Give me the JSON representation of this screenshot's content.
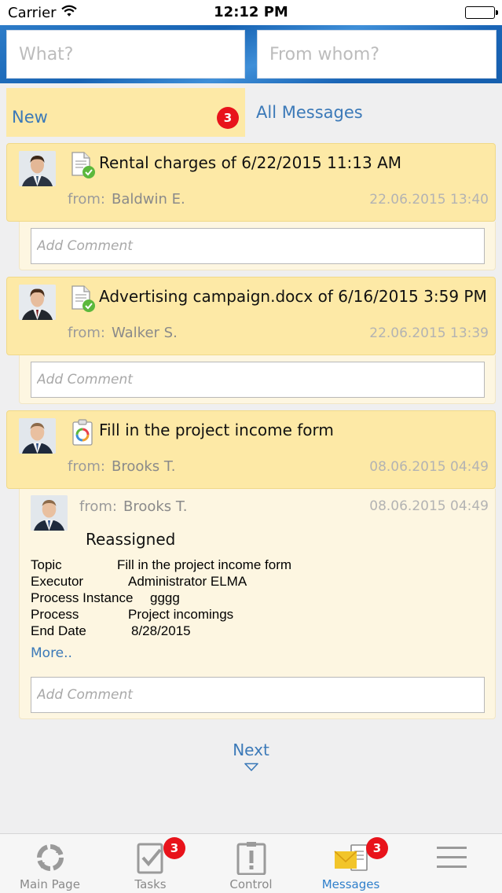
{
  "status_bar": {
    "carrier": "Carrier",
    "time": "12:12 PM"
  },
  "search": {
    "what_placeholder": "What?",
    "from_whom_placeholder": "From whom?"
  },
  "tabs": {
    "new_label": "New",
    "new_count": "3",
    "all_label": "All Messages"
  },
  "messages": [
    {
      "title": "Rental charges of 6/22/2015 11:13 AM",
      "from_label": "from:",
      "from": "Baldwin E.",
      "date": "22.06.2015 13:40",
      "comment_placeholder": "Add Comment"
    },
    {
      "title": "Advertising campaign.docx of 6/16/2015 3:59 PM",
      "from_label": "from:",
      "from": "Walker S.",
      "date": "22.06.2015 13:39",
      "comment_placeholder": "Add Comment"
    },
    {
      "title": "Fill in the project income form",
      "from_label": "from:",
      "from": "Brooks T.",
      "date": "08.06.2015 04:49",
      "comment_placeholder": "Add Comment",
      "detail": {
        "from_label": "from:",
        "from": "Brooks T.",
        "date": "08.06.2015 04:49",
        "status": "Reassigned",
        "properties": [
          {
            "key": "Topic",
            "value": "Fill in the project income form"
          },
          {
            "key": "Executor",
            "value": "Administrator ELMA"
          },
          {
            "key": "Process Instance",
            "value": "gggg"
          },
          {
            "key": "Process",
            "value": "Project incomings"
          },
          {
            "key": "End Date",
            "value": "8/28/2015"
          }
        ],
        "more": "More.."
      }
    }
  ],
  "pagination": {
    "next_label": "Next"
  },
  "bottom_nav": [
    {
      "label": "Main Page",
      "icon": "refresh-icon"
    },
    {
      "label": "Tasks",
      "icon": "checklist-icon",
      "badge": "3"
    },
    {
      "label": "Control",
      "icon": "exclamation-clipboard-icon"
    },
    {
      "label": "Messages",
      "icon": "envelope-icon",
      "badge": "3",
      "active": true
    },
    {
      "label": "",
      "icon": "hamburger-menu-icon"
    }
  ],
  "colors": {
    "accent": "#3b79b8",
    "card_bg": "#fde9a6",
    "badge": "#e8131b",
    "header_blue": "#1763b3"
  }
}
